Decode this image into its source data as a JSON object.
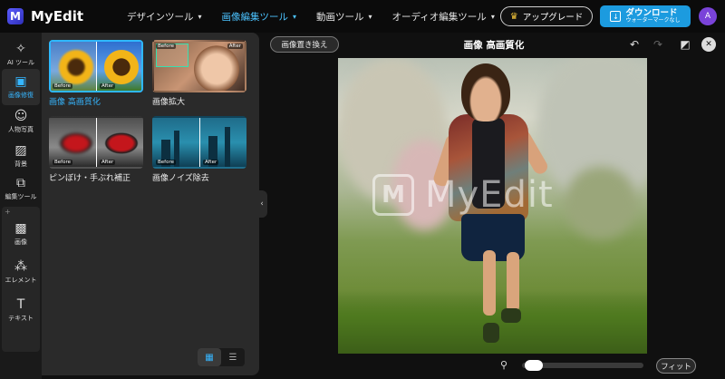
{
  "app": {
    "name": "MyEdit",
    "logo_letter": "M"
  },
  "nav": [
    {
      "label": "デザインツール",
      "active": false
    },
    {
      "label": "画像編集ツール",
      "active": true
    },
    {
      "label": "動画ツール",
      "active": false
    },
    {
      "label": "オーディオ編集ツール",
      "active": false
    }
  ],
  "header": {
    "upgrade_label": "アップグレード",
    "download_label": "ダウンロード",
    "download_sub": "ウォーターマークなし",
    "avatar_letter": "A"
  },
  "sidebar": {
    "items": [
      {
        "label": "AI ツール",
        "icon": "magic-wand-icon"
      },
      {
        "label": "画像修復",
        "icon": "image-repair-icon",
        "active": true
      },
      {
        "label": "人物写真",
        "icon": "portrait-icon"
      },
      {
        "label": "背景",
        "icon": "background-icon"
      },
      {
        "label": "編集ツール",
        "icon": "edit-tools-icon"
      }
    ],
    "add_items": [
      {
        "label": "画像",
        "icon": "image-icon"
      },
      {
        "label": "エレメント",
        "icon": "elements-icon"
      },
      {
        "label": "テキスト",
        "icon": "text-icon"
      }
    ]
  },
  "panel": {
    "tools": [
      {
        "label": "画像 高画質化",
        "before": "Before",
        "after": "After",
        "active": true
      },
      {
        "label": "画像拡大",
        "before": "Before",
        "after": "After"
      },
      {
        "label": "ピンぼけ・手ぶれ補正",
        "before": "Before",
        "after": "After"
      },
      {
        "label": "画像ノイズ除去",
        "before": "Before",
        "after": "After"
      }
    ],
    "view_mode": "grid"
  },
  "workspace": {
    "replace_label": "画像置き換え",
    "title": "画像 高画質化",
    "watermark_text": "MyEdit",
    "fit_label": "フィット",
    "zoom_level": 0.03
  },
  "colors": {
    "accent": "#36b6ff",
    "download": "#1c9bdf",
    "avatar": "#7a43d9"
  }
}
